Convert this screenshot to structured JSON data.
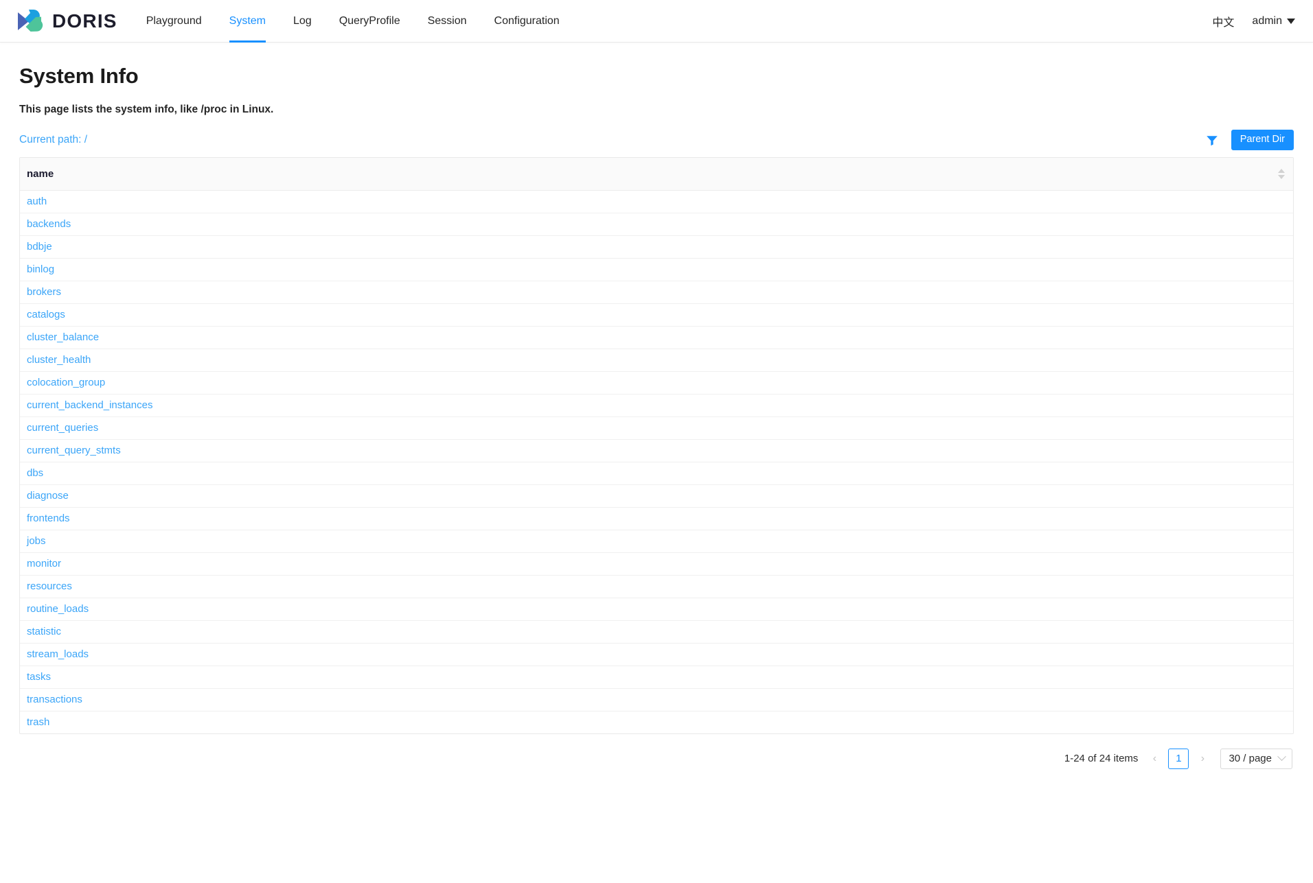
{
  "navbar": {
    "brand": "DORIS",
    "items": [
      {
        "label": "Playground",
        "active": false
      },
      {
        "label": "System",
        "active": true
      },
      {
        "label": "Log",
        "active": false
      },
      {
        "label": "QueryProfile",
        "active": false
      },
      {
        "label": "Session",
        "active": false
      },
      {
        "label": "Configuration",
        "active": false
      }
    ],
    "lang_switch": "中文",
    "user": "admin"
  },
  "page": {
    "title": "System Info",
    "description": "This page lists the system info, like /proc in Linux.",
    "current_path_label": "Current path: /",
    "parent_dir_label": "Parent Dir"
  },
  "table": {
    "columns": [
      "name"
    ],
    "rows": [
      "auth",
      "backends",
      "bdbje",
      "binlog",
      "brokers",
      "catalogs",
      "cluster_balance",
      "cluster_health",
      "colocation_group",
      "current_backend_instances",
      "current_queries",
      "current_query_stmts",
      "dbs",
      "diagnose",
      "frontends",
      "jobs",
      "monitor",
      "resources",
      "routine_loads",
      "statistic",
      "stream_loads",
      "tasks",
      "transactions",
      "trash"
    ]
  },
  "pagination": {
    "total_text": "1-24 of 24 items",
    "prev_label": "‹",
    "next_label": "›",
    "current_page": "1",
    "page_size_label": "30 / page"
  },
  "colors": {
    "accent": "#1890ff",
    "link": "#3ba5f8",
    "logo_blue": "#4a63b5",
    "logo_cyan": "#1ba0e0",
    "logo_green": "#4ec49a",
    "header_bg": "#fafafa",
    "text": "#262626"
  }
}
